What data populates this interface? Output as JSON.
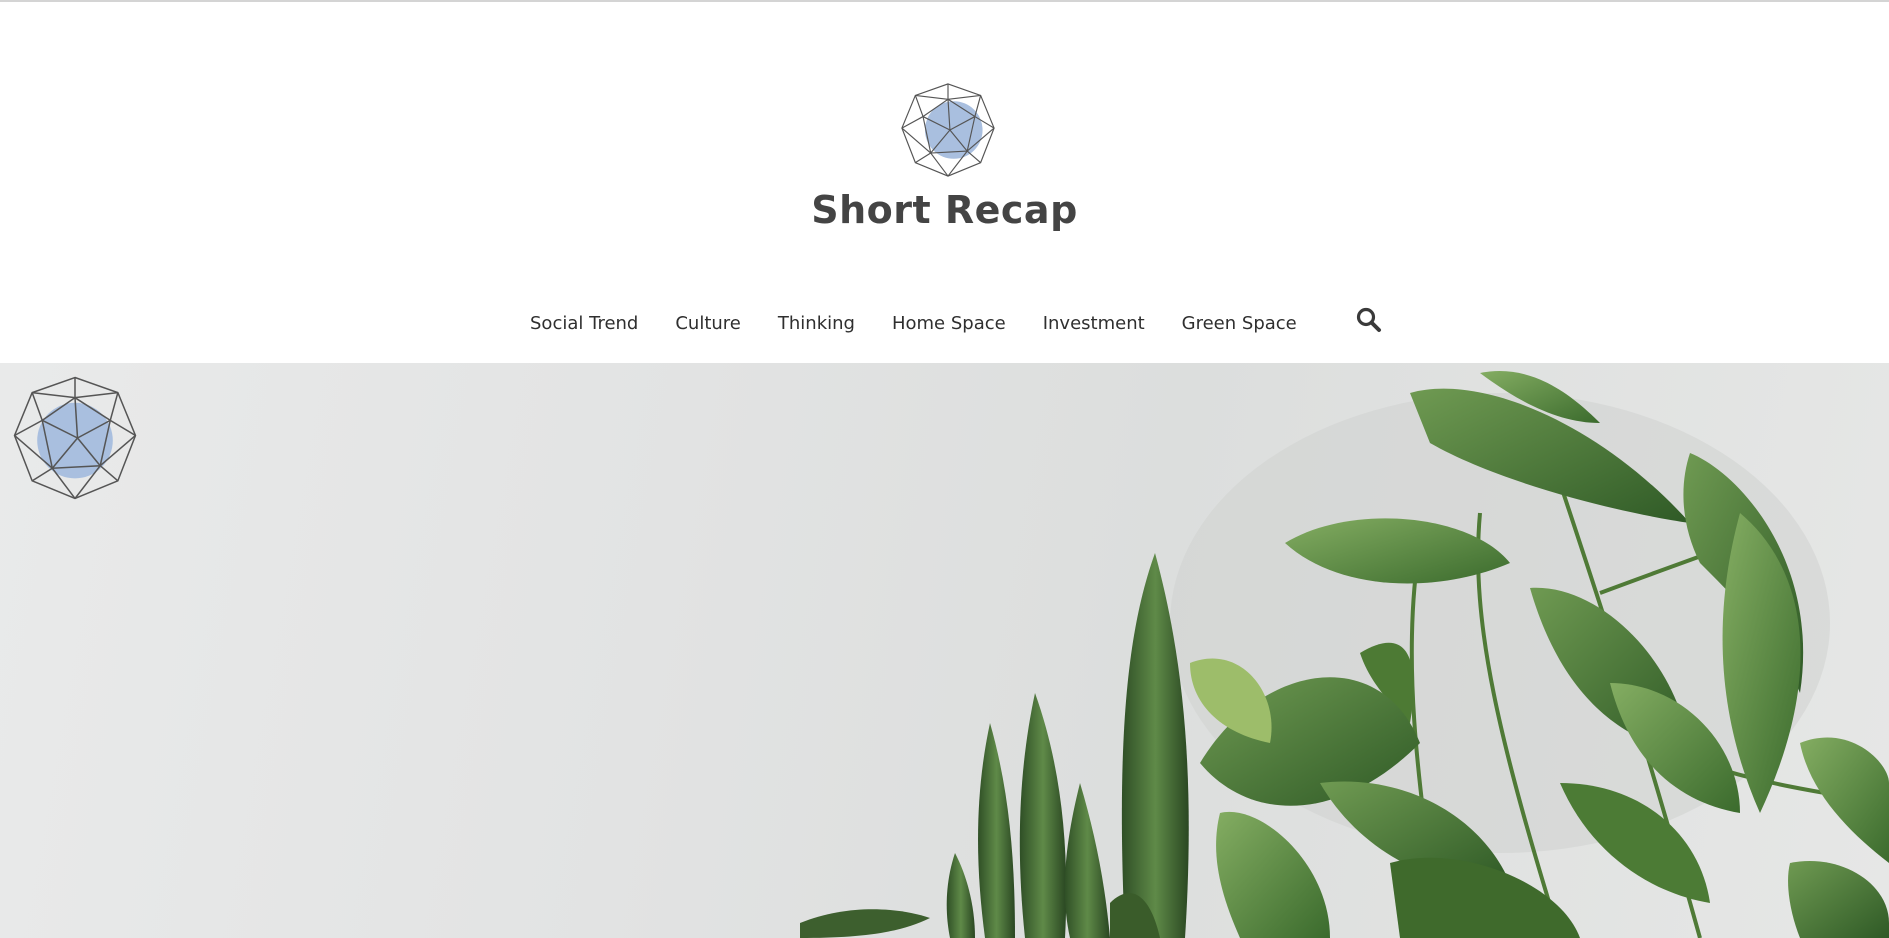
{
  "site": {
    "title": "Short Recap",
    "logo_icon": "geodesic-sphere-icon",
    "accent_color": "#a9bfdf"
  },
  "nav": {
    "items": [
      {
        "label": "Social Trend"
      },
      {
        "label": "Culture"
      },
      {
        "label": "Thinking"
      },
      {
        "label": "Home Space"
      },
      {
        "label": "Investment"
      },
      {
        "label": "Green Space"
      }
    ],
    "search_icon": "search-icon"
  },
  "hero": {
    "image": "indoor-plants-against-white-wall",
    "logo_icon": "geodesic-sphere-icon"
  }
}
